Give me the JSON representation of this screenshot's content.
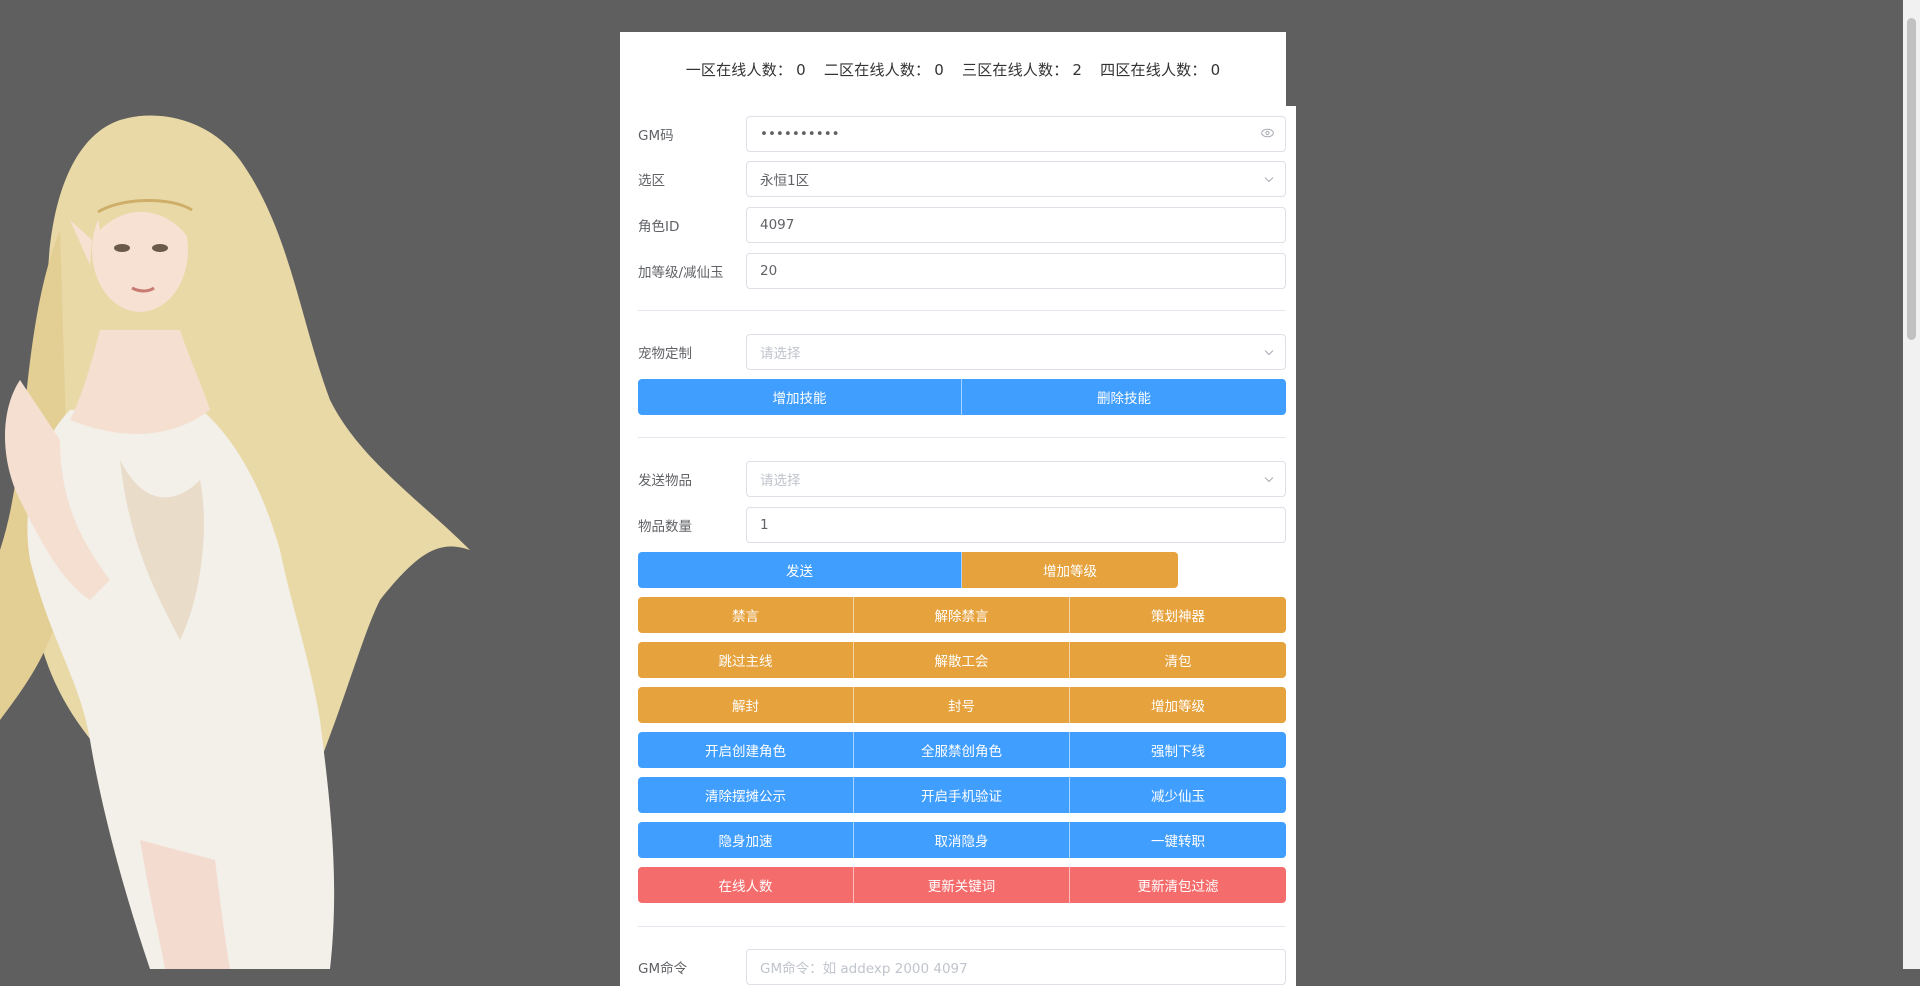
{
  "header": {
    "stats": [
      {
        "label": "一区在线人数：",
        "value": "0"
      },
      {
        "label": "二区在线人数：",
        "value": "0"
      },
      {
        "label": "三区在线人数：",
        "value": "2"
      },
      {
        "label": "四区在线人数：",
        "value": "0"
      }
    ]
  },
  "form": {
    "gm_code": {
      "label": "GM码",
      "value": "••••••••••"
    },
    "zone": {
      "label": "选区",
      "value": "永恒1区"
    },
    "role_id": {
      "label": "角色ID",
      "value": "4097"
    },
    "level_add": {
      "label": "加等级/减仙玉",
      "value": "20"
    },
    "pet_custom": {
      "label": "宠物定制",
      "placeholder": "请选择"
    },
    "send_item": {
      "label": "发送物品",
      "placeholder": "请选择"
    },
    "item_qty": {
      "label": "物品数量",
      "value": "1"
    },
    "gm_command": {
      "label": "GM命令",
      "placeholder": "GM命令：如 addexp 2000 4097"
    }
  },
  "buttons": {
    "pet": [
      "增加技能",
      "删除技能"
    ],
    "send": [
      "发送",
      "增加等级"
    ],
    "grid": [
      [
        "禁言",
        "解除禁言",
        "策划神器"
      ],
      [
        "跳过主线",
        "解散工会",
        "清包"
      ],
      [
        "解封",
        "封号",
        "增加等级"
      ],
      [
        "开启创建角色",
        "全服禁创角色",
        "强制下线"
      ],
      [
        "清除摆摊公示",
        "开启手机验证",
        "减少仙玉"
      ],
      [
        "隐身加速",
        "取消隐身",
        "一键转职"
      ],
      [
        "在线人数",
        "更新关键词",
        "更新清包过滤"
      ]
    ]
  },
  "colors": {
    "primary": "#409eff",
    "warning": "#e6a23c",
    "danger": "#f56c6c",
    "page_bg": "#5f5f5f"
  }
}
